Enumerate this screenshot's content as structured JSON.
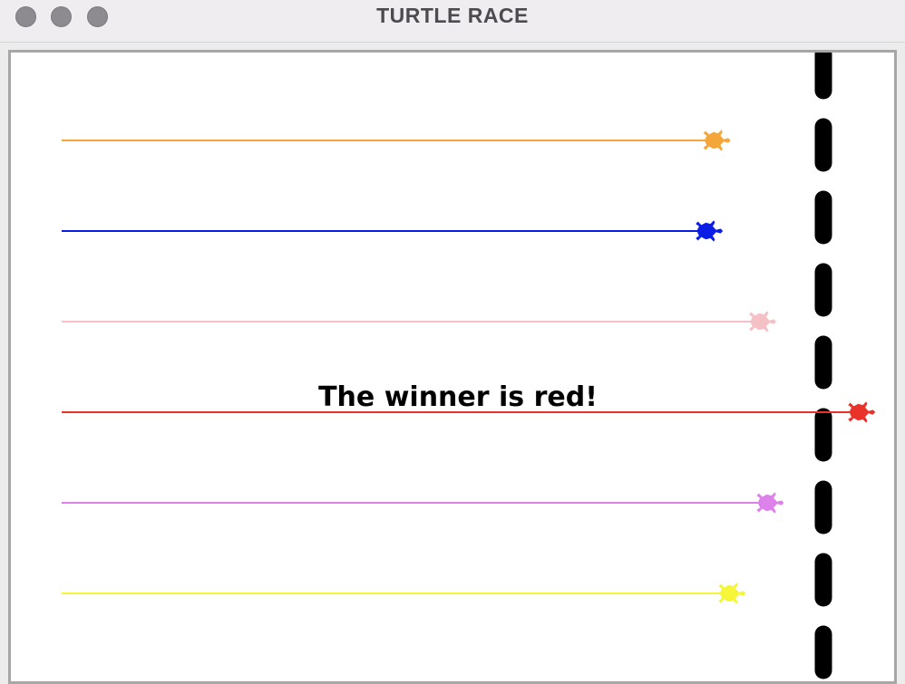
{
  "window": {
    "title": "TURTLE RACE"
  },
  "race": {
    "winner_message": "The winner is red!",
    "winner": "red",
    "turtles": [
      {
        "color_name": "orange",
        "color": "#f4a63a",
        "progress": 0.84
      },
      {
        "color_name": "blue",
        "color": "#0a1de6",
        "progress": 0.83
      },
      {
        "color_name": "pink",
        "color": "#f5c0c6",
        "progress": 0.9
      },
      {
        "color_name": "red",
        "color": "#e8322a",
        "progress": 1.03
      },
      {
        "color_name": "violet",
        "color": "#dd82ea",
        "progress": 0.91
      },
      {
        "color_name": "yellow",
        "color": "#f5f53a",
        "progress": 0.86
      }
    ]
  }
}
